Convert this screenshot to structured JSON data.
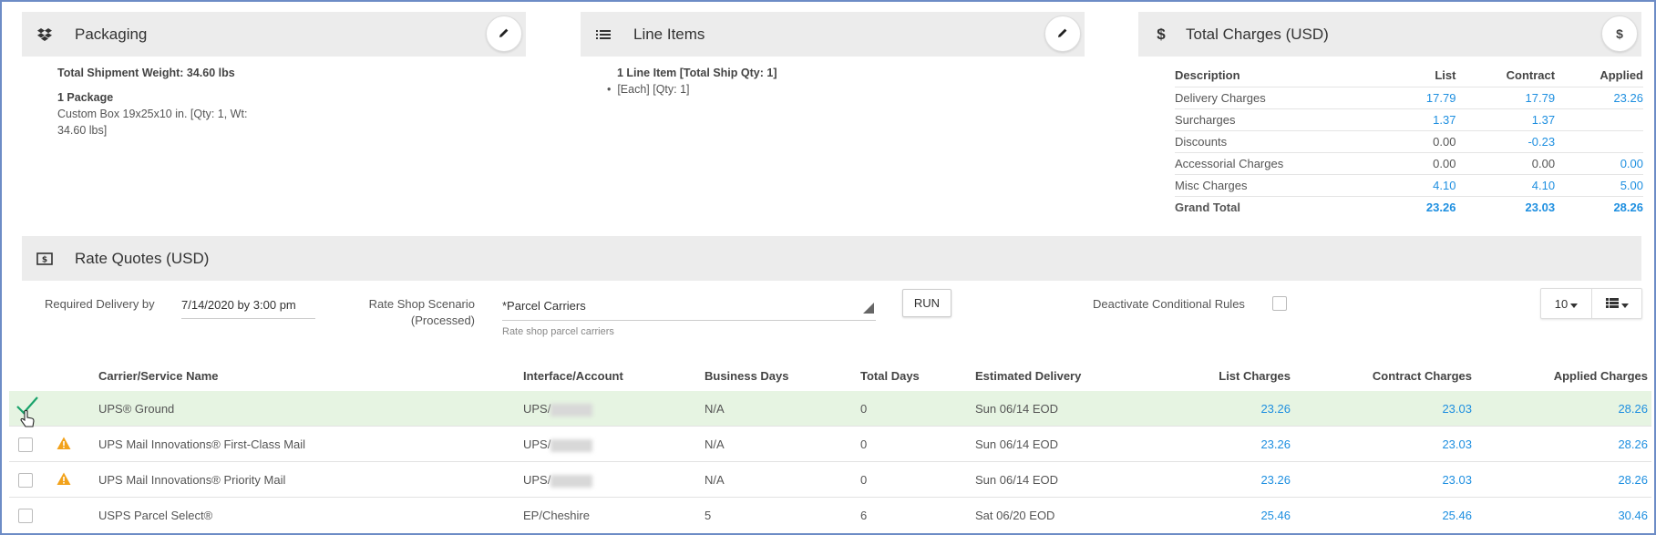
{
  "packaging": {
    "title": "Packaging",
    "total_weight": "Total Shipment Weight: 34.60 lbs",
    "package_count": "1 Package",
    "package_desc_line1": "Custom Box 19x25x10 in. [Qty: 1, Wt:",
    "package_desc_line2": "34.60 lbs]"
  },
  "line_items": {
    "title": "Line Items",
    "summary": "1 Line Item [Total Ship Qty: 1]",
    "bullet": "[Each] [Qty: 1]"
  },
  "total_charges": {
    "title": "Total Charges (USD)",
    "columns": [
      "Description",
      "List",
      "Contract",
      "Applied"
    ],
    "rows": [
      {
        "desc": "Delivery Charges",
        "list": "17.79",
        "contract": "17.79",
        "applied": "23.26"
      },
      {
        "desc": "Surcharges",
        "list": "1.37",
        "contract": "1.37",
        "applied": ""
      },
      {
        "desc": "Discounts",
        "list": "0.00",
        "contract": "-0.23",
        "applied": ""
      },
      {
        "desc": "Accessorial Charges",
        "list": "0.00",
        "contract": "0.00",
        "applied": "0.00"
      },
      {
        "desc": "Misc Charges",
        "list": "4.10",
        "contract": "4.10",
        "applied": "5.00"
      },
      {
        "desc": "Grand Total",
        "list": "23.26",
        "contract": "23.03",
        "applied": "28.26"
      }
    ]
  },
  "rate_quotes": {
    "title": "Rate Quotes (USD)",
    "required_delivery_label": "Required Delivery by",
    "required_delivery_value": "7/14/2020 by 3:00 pm",
    "scenario_label_1": "Rate Shop Scenario",
    "scenario_label_2": "(Processed)",
    "scenario_value": "*Parcel Carriers",
    "scenario_hint": "Rate shop parcel carriers",
    "run_label": "RUN",
    "deactivate_label": "Deactivate Conditional Rules",
    "page_size": "10",
    "columns": {
      "carrier": "Carrier/Service Name",
      "interface": "Interface/Account",
      "business_days": "Business Days",
      "total_days": "Total Days",
      "estimated": "Estimated Delivery",
      "list": "List Charges",
      "contract": "Contract Charges",
      "applied": "Applied Charges"
    },
    "rows": [
      {
        "carrier": "UPS® Ground",
        "interface": "UPS/",
        "business_days": "N/A",
        "total_days": "0",
        "estimated": "Sun 06/14 EOD",
        "list": "23.26",
        "contract": "23.03",
        "applied": "28.26"
      },
      {
        "carrier": "UPS Mail Innovations® First-Class Mail",
        "interface": "UPS/",
        "business_days": "N/A",
        "total_days": "0",
        "estimated": "Sun 06/14 EOD",
        "list": "23.26",
        "contract": "23.03",
        "applied": "28.26"
      },
      {
        "carrier": "UPS Mail Innovations® Priority Mail",
        "interface": "UPS/",
        "business_days": "N/A",
        "total_days": "0",
        "estimated": "Sun 06/14 EOD",
        "list": "23.26",
        "contract": "23.03",
        "applied": "28.26"
      },
      {
        "carrier": "USPS Parcel Select®",
        "interface": "EP/Cheshire",
        "business_days": "5",
        "total_days": "6",
        "estimated": "Sat 06/20 EOD",
        "list": "25.46",
        "contract": "25.46",
        "applied": "30.46"
      }
    ]
  },
  "colors": {
    "accent_blue": "#1e8fe0",
    "selected_row": "#e6f4e2",
    "check_green": "#1aa36b",
    "warning_orange": "#f2a21b",
    "panel_header": "#ececec"
  }
}
